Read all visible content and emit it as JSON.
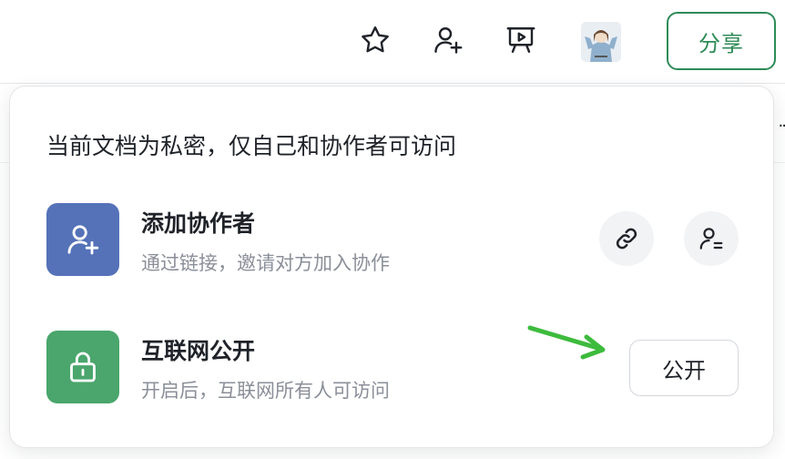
{
  "toolbar": {
    "icons": [
      "star-icon",
      "add-collaborator-icon",
      "presentation-icon"
    ],
    "share_label": "分享",
    "accent": "#2e8b57"
  },
  "panel": {
    "title": "当前文档为私密，仅自己和协作者可访问",
    "collaborator": {
      "title": "添加协作者",
      "subtitle": "通过链接，邀请对方加入协作",
      "icon": "add-user-icon",
      "icon_bg": "#5572b8",
      "actions": [
        "link-icon",
        "member-list-icon"
      ]
    },
    "public": {
      "title": "互联网公开",
      "subtitle": "开启后，互联网所有人可访问",
      "icon": "lock-icon",
      "icon_bg": "#4aa66c",
      "button_label": "公开"
    }
  },
  "annotation": {
    "arrow_color": "#3dbb3d"
  }
}
